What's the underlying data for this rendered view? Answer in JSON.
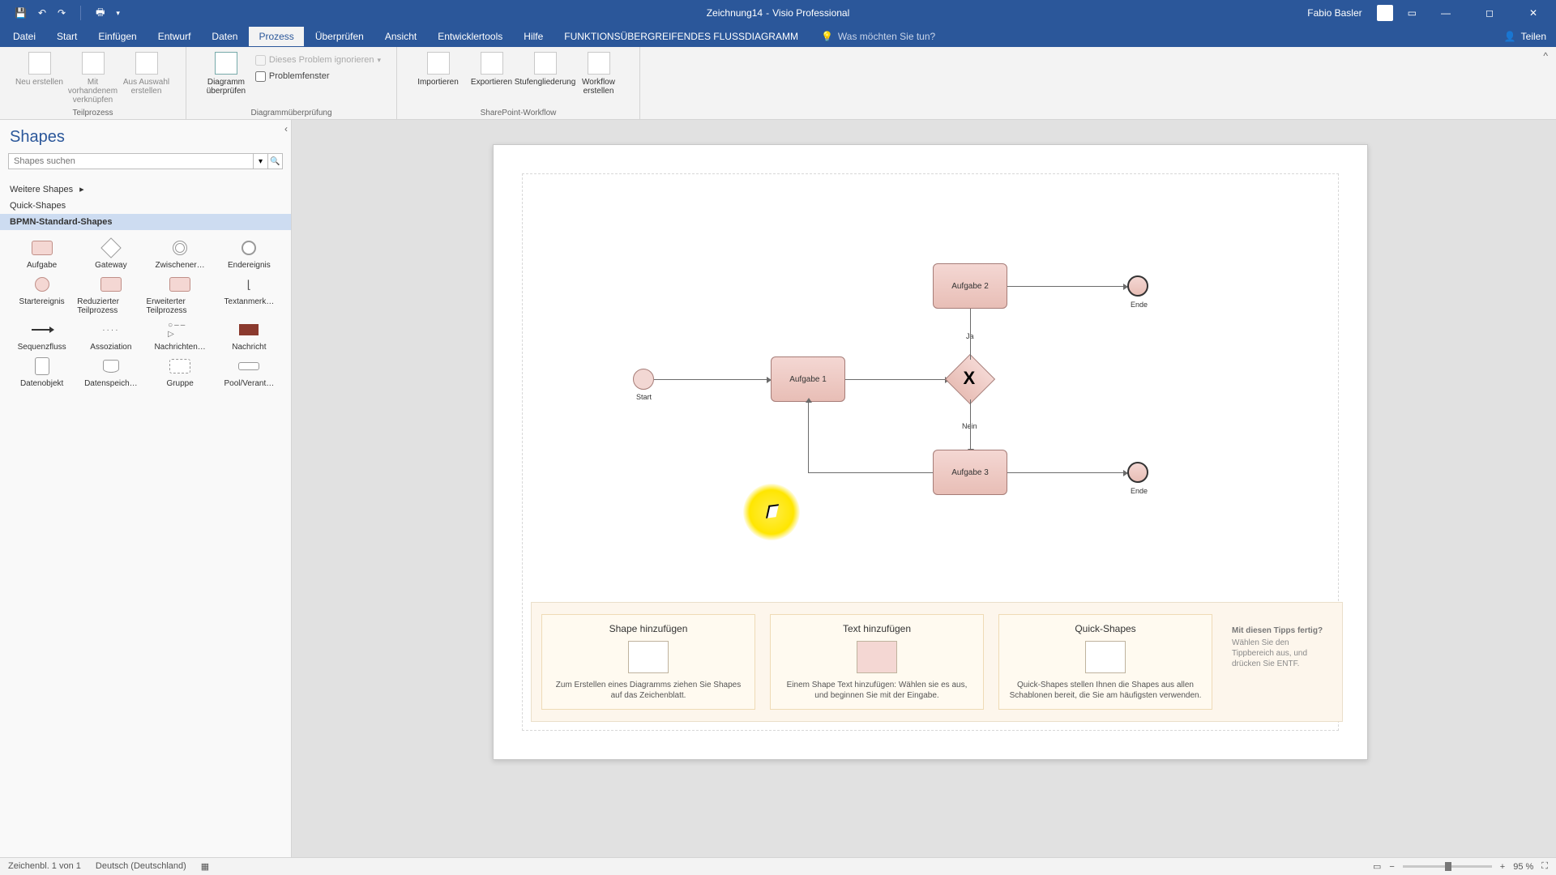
{
  "titlebar": {
    "doc": "Zeichnung14",
    "app": "Visio Professional",
    "user": "Fabio Basler"
  },
  "menu": {
    "items": [
      "Datei",
      "Start",
      "Einfügen",
      "Entwurf",
      "Daten",
      "Prozess",
      "Überprüfen",
      "Ansicht",
      "Entwicklertools",
      "Hilfe",
      "FUNKTIONSÜBERGREIFENDES FLUSSDIAGRAMM"
    ],
    "active_index": 5,
    "tellme_placeholder": "Was möchten Sie tun?",
    "share": "Teilen"
  },
  "ribbon": {
    "group_teilprozess": {
      "title": "Teilprozess",
      "btn_neu": "Neu erstellen",
      "btn_vorhanden": "Mit vorhandenem verknüpfen",
      "btn_auswahl": "Aus Auswahl erstellen"
    },
    "group_diagram": {
      "title": "Diagrammüberprüfung",
      "btn_check": "Diagramm überprüfen",
      "chk_ignore": "Dieses Problem ignorieren",
      "chk_problem": "Problemfenster"
    },
    "group_sp": {
      "title": "SharePoint-Workflow",
      "btn_import": "Importieren",
      "btn_export": "Exportieren",
      "btn_stufen": "Stufengliederung",
      "btn_workflow": "Workflow erstellen"
    }
  },
  "shapes": {
    "title": "Shapes",
    "search_placeholder": "Shapes suchen",
    "more": "Weitere Shapes",
    "stencils": [
      "Quick-Shapes",
      "BPMN-Standard-Shapes"
    ],
    "selected_stencil_index": 1,
    "items": [
      "Aufgabe",
      "Gateway",
      "Zwischener…",
      "Endereignis",
      "Startereignis",
      "Reduzierter Teilprozess",
      "Erweiterter Teilprozess",
      "Textanmerk…",
      "Sequenzfluss",
      "Assoziation",
      "Nachrichten…",
      "Nachricht",
      "Datenobjekt",
      "Datenspeich…",
      "Gruppe",
      "Pool/Verant…"
    ]
  },
  "canvas": {
    "start_label": "Start",
    "task1": "Aufgabe 1",
    "task2": "Aufgabe 2",
    "task3": "Aufgabe 3",
    "gateway_ja": "Ja",
    "gateway_nein": "Nein",
    "end_label": "Ende"
  },
  "tips": {
    "card_shape_title": "Shape hinzufügen",
    "card_shape_body": "Zum Erstellen eines Diagramms ziehen Sie Shapes auf das Zeichenblatt.",
    "card_text_title": "Text hinzufügen",
    "card_text_body": "Einem Shape Text hinzufügen: Wählen sie es aus, und beginnen Sie mit der Eingabe.",
    "card_quick_title": "Quick-Shapes",
    "card_quick_body": "Quick-Shapes stellen Ihnen die Shapes aus allen Schablonen bereit, die Sie am häufigsten verwenden.",
    "hint_title": "Mit diesen Tipps fertig?",
    "hint_body": "Wählen Sie den Tippbereich aus, und drücken Sie ENTF."
  },
  "status": {
    "page": "Zeichenbl. 1 von 1",
    "lang": "Deutsch (Deutschland)",
    "zoom": "95 %"
  }
}
